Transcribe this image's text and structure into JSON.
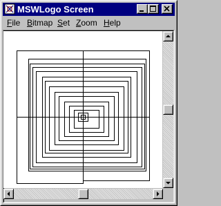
{
  "window": {
    "title": "MSWLogo Screen",
    "title_bar_color": "#000080",
    "face_color": "#c0c0c0",
    "canvas_color": "#ffffff",
    "buttons": [
      "minimize-icon",
      "maximize-icon",
      "close-icon"
    ]
  },
  "menu": [
    {
      "label": "File",
      "accel": "F",
      "rest": "ile"
    },
    {
      "label": "Bitmap",
      "accel": "B",
      "rest": "itmap"
    },
    {
      "label": "Set",
      "accel": "S",
      "rest": "et"
    },
    {
      "label": "Zoom",
      "accel": "Z",
      "rest": "oom"
    },
    {
      "label": "Help",
      "accel": "H",
      "rest": "elp"
    }
  ],
  "drawing": {
    "description_icon": "logo-turtle-square-spiral",
    "stroke_color": "#000000"
  },
  "scrollbars": {
    "vertical_position": 0.5,
    "horizontal_position": 0.5
  }
}
